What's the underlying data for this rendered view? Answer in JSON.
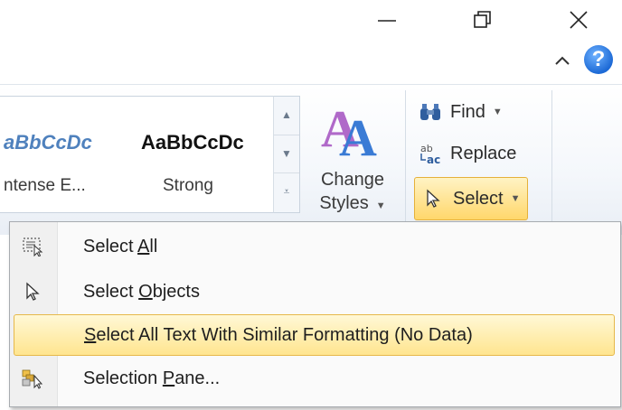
{
  "window": {
    "minimize_glyph": "—",
    "restore_glyph": "❐",
    "close_glyph": "✕"
  },
  "help": {
    "glyph": "?"
  },
  "styles_gallery": {
    "items": [
      {
        "preview": "aBbCcDc",
        "label": "ntense E..."
      },
      {
        "preview": "AaBbCcDc",
        "label": "Strong"
      }
    ]
  },
  "change_styles": {
    "line1": "Change",
    "line2": "Styles"
  },
  "editing": {
    "find": "Find",
    "replace": "Replace",
    "select": "Select"
  },
  "select_menu": {
    "items": [
      {
        "pre": "Select ",
        "key": "A",
        "post": "ll",
        "icon": "select-all-icon"
      },
      {
        "pre": "Select ",
        "key": "O",
        "post": "bjects",
        "icon": "select-objects-icon"
      },
      {
        "pre": "",
        "key": "S",
        "post": "elect All Text With Similar Formatting (No Data)",
        "icon": "none",
        "highlighted": true
      },
      {
        "pre": "Selection ",
        "key": "P",
        "post": "ane...",
        "icon": "selection-pane-icon"
      }
    ]
  },
  "colors": {
    "highlight": "#ffe58f",
    "highlight_border": "#e6b84a",
    "help_blue": "#1d6ad6",
    "italic_style_blue": "#4f81bd"
  }
}
